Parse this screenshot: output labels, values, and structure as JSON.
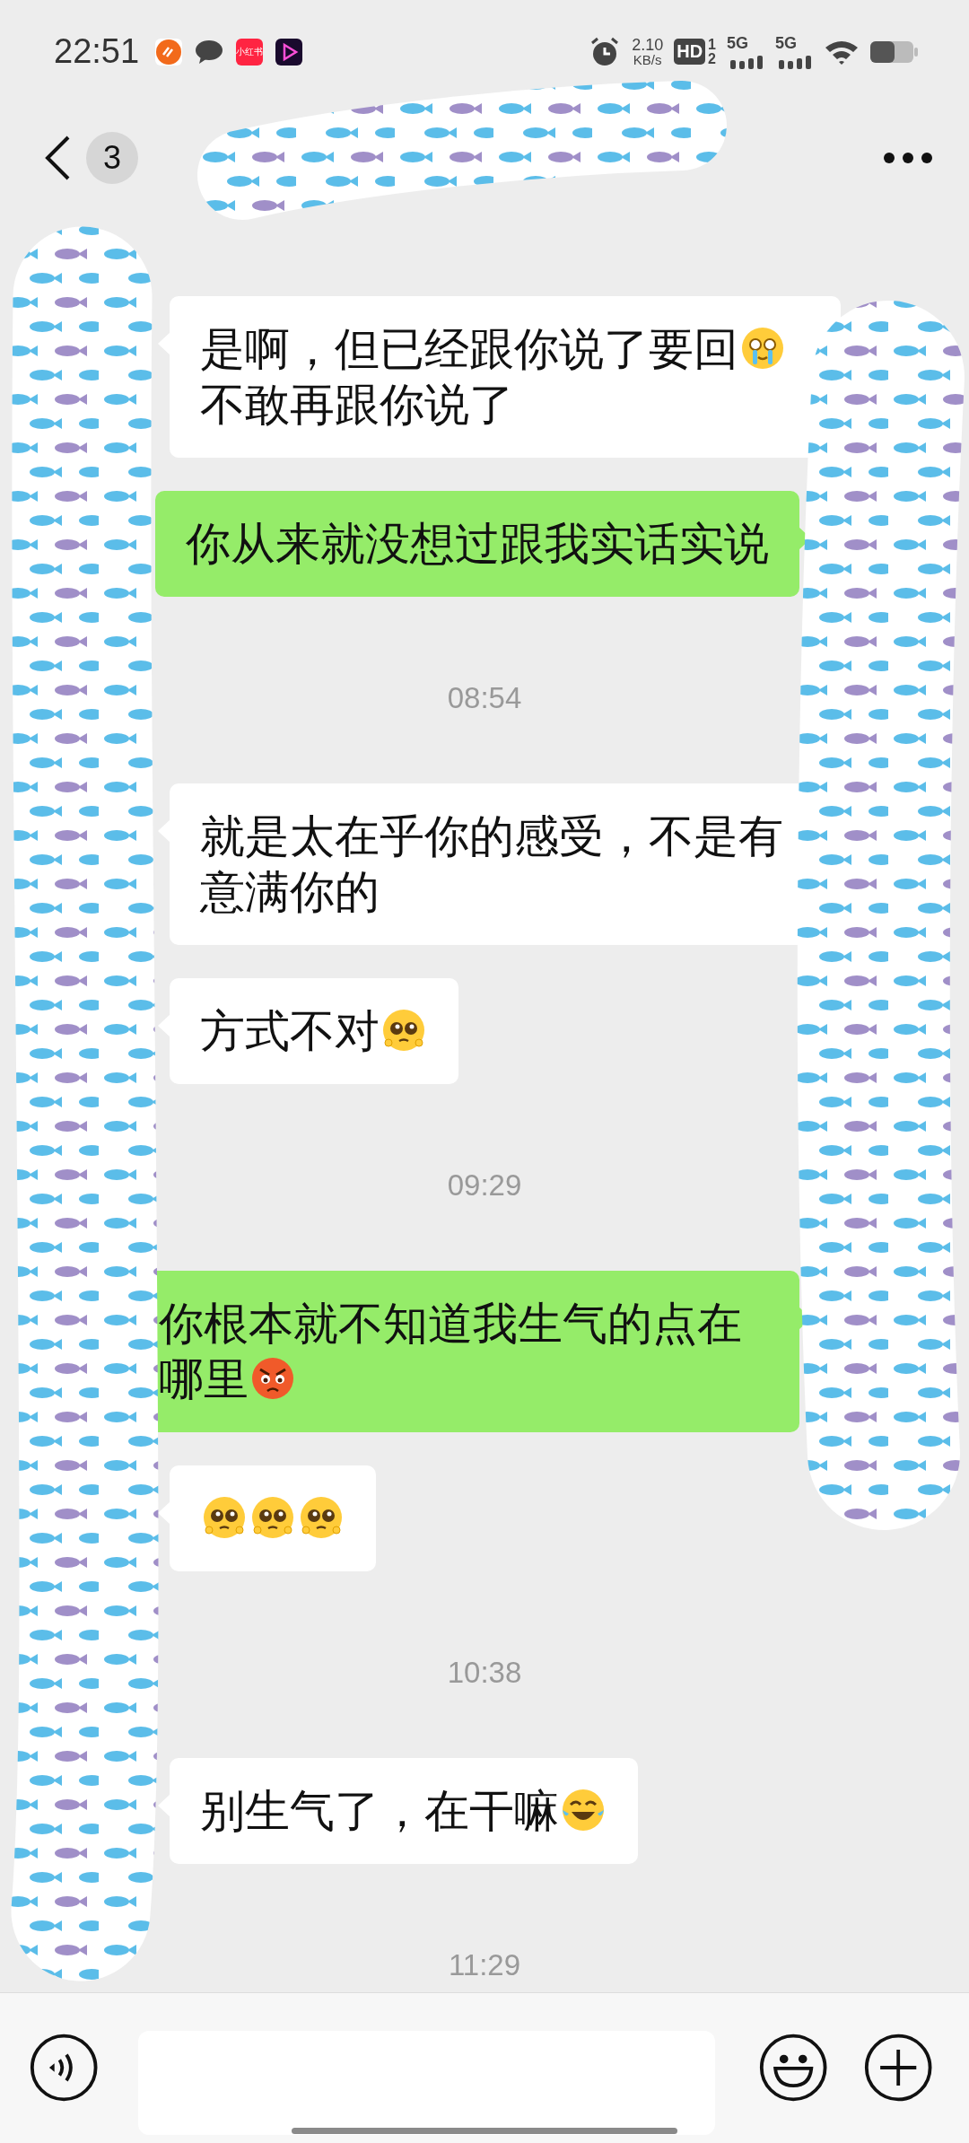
{
  "status_bar": {
    "time": "22:51",
    "app_icons": [
      {
        "kind": "orange"
      },
      {
        "kind": "bubble"
      },
      {
        "kind": "red",
        "label": "小红书"
      },
      {
        "kind": "play"
      }
    ],
    "speed": "2.10",
    "speed_unit": "KB/s",
    "hd": "HD",
    "sim_marks": [
      "1",
      "2"
    ],
    "networks": [
      "5G",
      "5G"
    ]
  },
  "header": {
    "unread": "3"
  },
  "chat": [
    {
      "kind": "received",
      "segments": [
        {
          "kind": "text",
          "text": "是啊，但已经跟你说了要回"
        },
        {
          "kind": "crying"
        },
        {
          "kind": "text",
          "text": "不敢再跟你说了"
        }
      ]
    },
    {
      "kind": "sent",
      "segments": [
        {
          "kind": "text",
          "text": "你从来就没想过跟我实话实说"
        }
      ]
    },
    {
      "kind": "time",
      "text": "08:54"
    },
    {
      "kind": "received",
      "segments": [
        {
          "kind": "text",
          "text": "就是太在乎你的感受，不是有意满你的"
        }
      ]
    },
    {
      "kind": "received",
      "segments": [
        {
          "kind": "text",
          "text": "方式不对"
        },
        {
          "kind": "pleading"
        }
      ]
    },
    {
      "kind": "time",
      "text": "09:29"
    },
    {
      "kind": "sent",
      "segments": [
        {
          "kind": "text",
          "text": "你根本就不知道我生气的点在"
        },
        {
          "kind": "text",
          "text": "哪里"
        },
        {
          "kind": "angry"
        }
      ]
    },
    {
      "kind": "received",
      "segments": [
        {
          "kind": "pleading"
        },
        {
          "kind": "pleading"
        },
        {
          "kind": "pleading"
        }
      ]
    },
    {
      "kind": "time",
      "text": "10:38"
    },
    {
      "kind": "received",
      "segments": [
        {
          "kind": "text",
          "text": "别生气了，在干嘛"
        },
        {
          "kind": "laughing"
        }
      ]
    },
    {
      "kind": "time",
      "text": "11:29"
    }
  ],
  "redactions": [
    {
      "kind": "title"
    },
    {
      "kind": "left"
    },
    {
      "kind": "right"
    }
  ]
}
